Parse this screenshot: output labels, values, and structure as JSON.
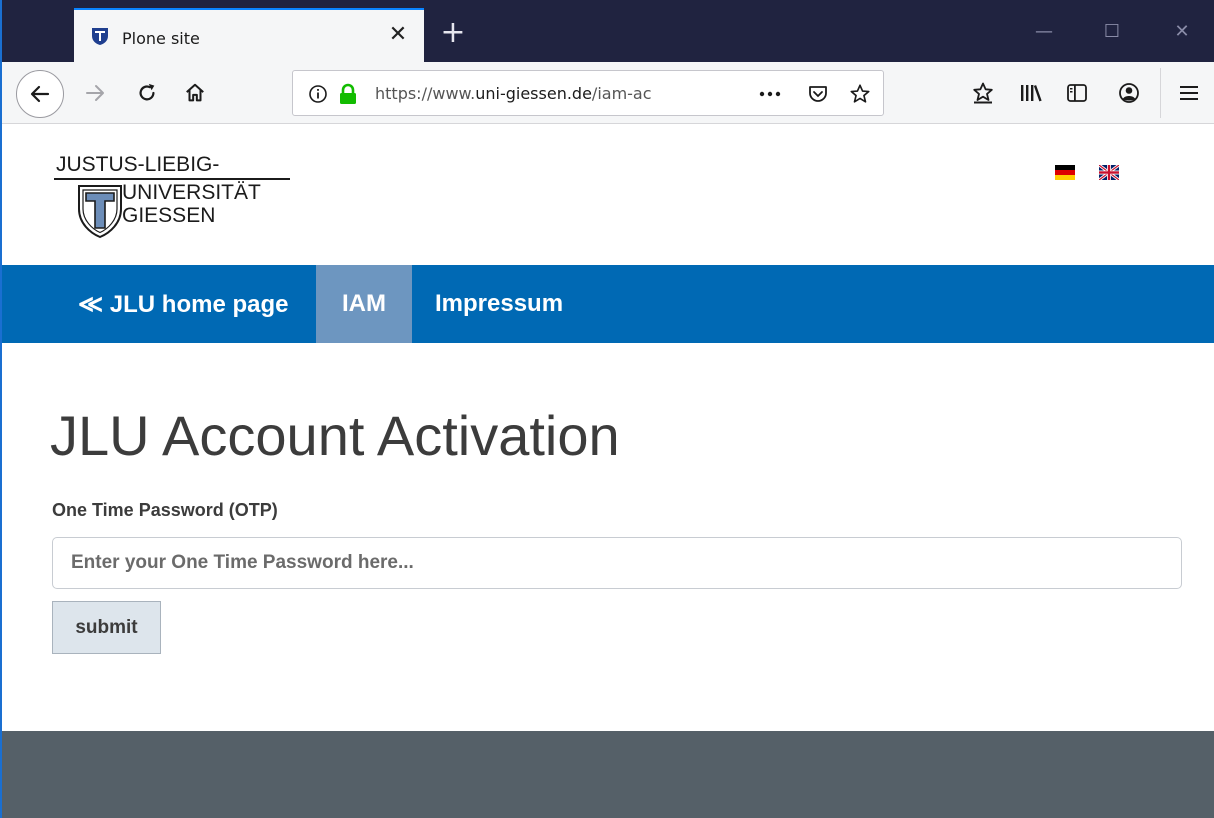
{
  "browser": {
    "tab_title": "Plone site",
    "tab_close": "✕",
    "new_tab": "+",
    "url_scheme": "https://www.",
    "url_host": "uni-giessen.de",
    "url_path": "/iam-ac",
    "window_controls": {
      "minimize": "—",
      "maximize": "☐",
      "close": "✕"
    },
    "icons": [
      "back-arrow-icon",
      "forward-arrow-icon",
      "reload-icon",
      "home-icon",
      "info-icon",
      "lock-icon",
      "more-icon",
      "pocket-icon",
      "bookmark-star-icon",
      "bookmarks-star-icon",
      "library-icon",
      "sidebar-icon",
      "account-icon",
      "menu-icon"
    ]
  },
  "site": {
    "logo": {
      "line1": "JUSTUS-LIEBIG-",
      "line2": "UNIVERSITÄT",
      "line3": "GIESSEN"
    },
    "languages": [
      "de",
      "en"
    ],
    "nav": {
      "home_link": "≪ JLU home page",
      "iam": "IAM",
      "impressum": "Impressum"
    },
    "colors": {
      "nav": "#0069b4",
      "nav_active": "#6d96c0",
      "footer": "#556068"
    }
  },
  "form": {
    "heading": "JLU Account Activation",
    "otp_label": "One Time Password (OTP)",
    "otp_placeholder": "Enter your One Time Password here...",
    "otp_value": "",
    "submit_label": "submit"
  }
}
